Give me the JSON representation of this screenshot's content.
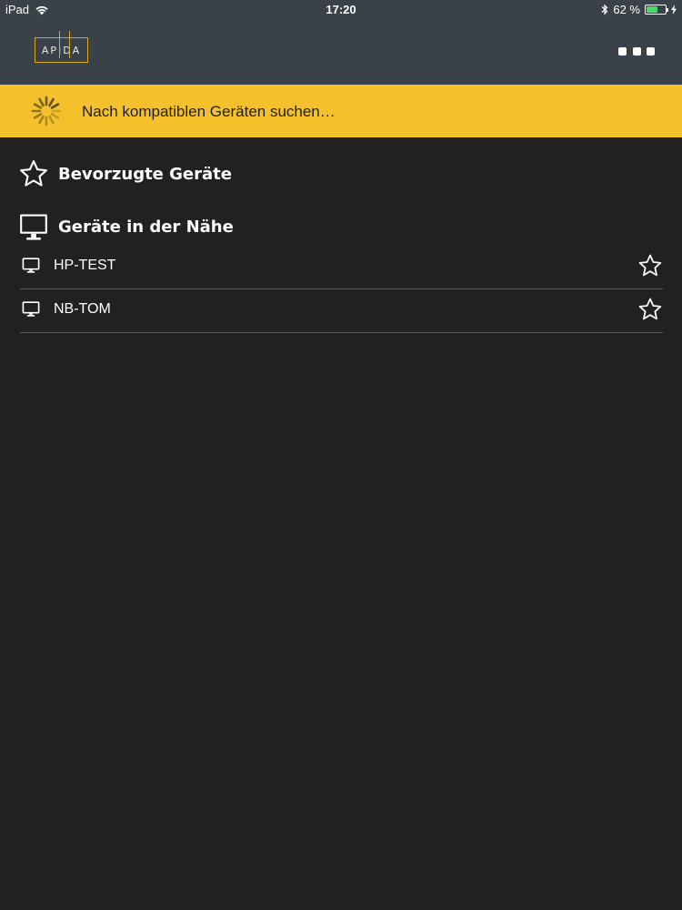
{
  "status_bar": {
    "device": "iPad",
    "time": "17:20",
    "battery_text": "62 %",
    "battery_level": 0.62
  },
  "navbar": {
    "logo_text": "APIDA",
    "menu_icon": "more-dots-icon"
  },
  "banner": {
    "text": "Nach kompatiblen Geräten suchen…",
    "background": "#f4c12d",
    "icon": "spinner-icon"
  },
  "favorites": {
    "title": "Bevorzugte Geräte",
    "icon": "star-outline-icon"
  },
  "nearby": {
    "title": "Geräte in der Nähe",
    "icon": "monitor-icon",
    "devices": [
      {
        "name": "HP-TEST",
        "icon": "monitor-icon",
        "favorite_icon": "star-outline-icon"
      },
      {
        "name": "NB-TOM",
        "icon": "monitor-icon",
        "favorite_icon": "star-outline-icon"
      }
    ]
  },
  "colors": {
    "background": "#212121",
    "navbar": "#3a4148",
    "accent": "#f4c12d",
    "logo_border": "#d9a826"
  }
}
